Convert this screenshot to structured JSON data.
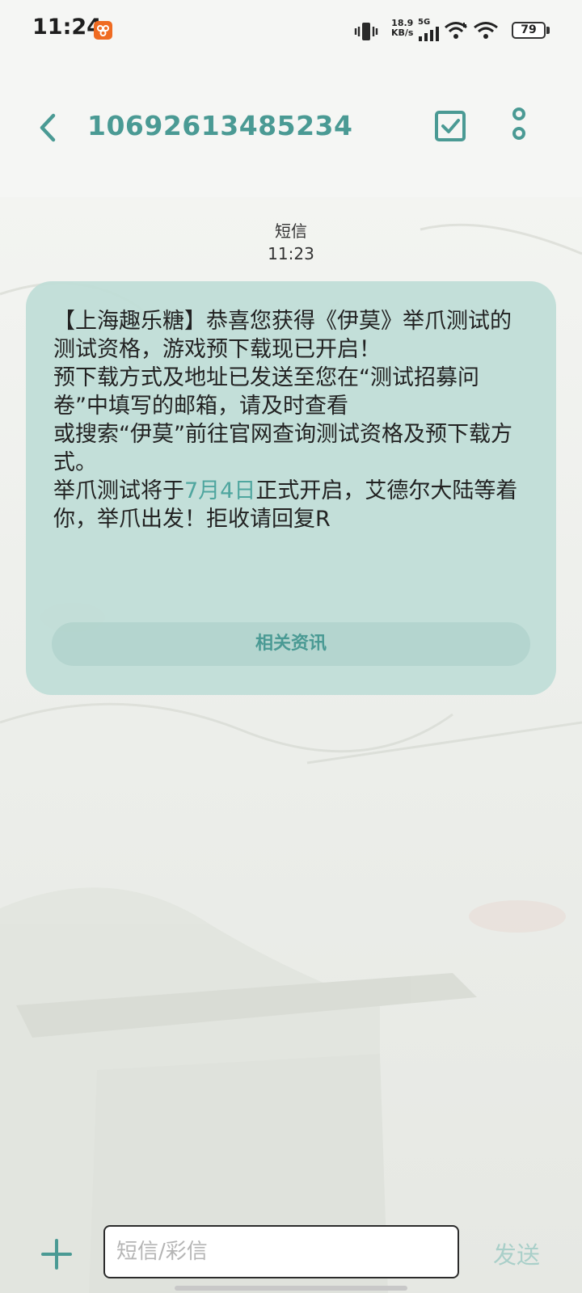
{
  "status_bar": {
    "time": "11:24",
    "net_speed_value": "18.9",
    "net_speed_unit": "KB/s",
    "network_type": "5G",
    "battery": "79",
    "icons": [
      "vibrate-icon",
      "signal-icon",
      "wifi-icon",
      "wifi-icon",
      "battery-icon"
    ]
  },
  "header": {
    "title": "10692613485234",
    "icons": [
      "back-icon",
      "select-check-icon",
      "more-icon"
    ]
  },
  "message_meta": {
    "type": "短信",
    "time": "11:23"
  },
  "message": {
    "lines": [
      "【上海趣乐糖】恭喜您获得《伊莫》举爪测试的测试资格，游戏预下载现已开启！",
      "预下载方式及地址已发送至您在“测试招募问卷”中填写的邮箱，请及时查看",
      "或搜索“伊莫”前往官网查询测试资格及预下载方式。"
    ],
    "last_line_prefix": "举爪测试将于",
    "date_link": "7月4日",
    "last_line_suffix": "正式开启，艾德尔大陆等着你，举爪出发！拒收请回复R",
    "related_button": "相关资讯"
  },
  "composer": {
    "placeholder": "短信/彩信",
    "send_label": "发送",
    "icons": [
      "plus-icon"
    ]
  },
  "colors": {
    "accent": "#4a9a94",
    "bubble": "#bfddd7",
    "send_disabled": "#a9cfc9"
  }
}
